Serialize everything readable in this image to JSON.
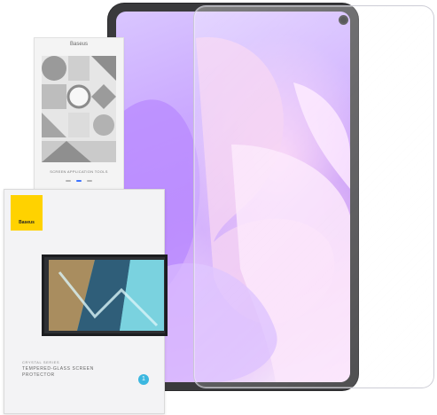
{
  "kit": {
    "brand": "Baseus",
    "title": "SCREEN APPLICATION TOOLS"
  },
  "box": {
    "brand": "Baseus",
    "series": "CRYSTAL SERIES",
    "title_line1": "TEMPERED-GLASS SCREEN",
    "title_line2": "PROTECTOR",
    "badge": "1"
  },
  "colors": {
    "brand_yellow": "#ffd200",
    "tablet_frame": "#3a3a3c",
    "badge_blue": "#3bb7e0"
  }
}
